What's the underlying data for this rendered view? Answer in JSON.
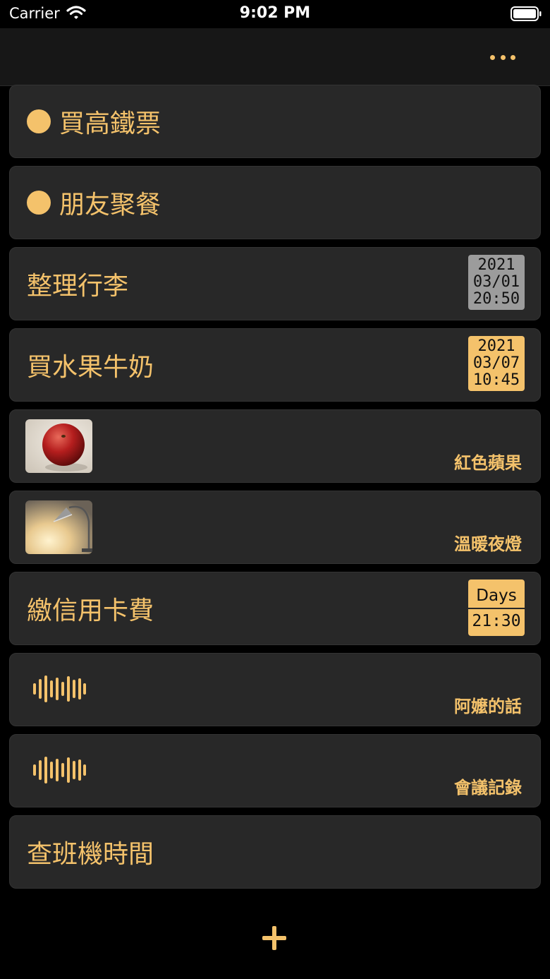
{
  "status_bar": {
    "carrier": "Carrier",
    "time": "9:02 PM"
  },
  "nav": {
    "more_icon": "ellipsis-icon"
  },
  "items": [
    {
      "kind": "dot",
      "title": "買高鐵票"
    },
    {
      "kind": "dot",
      "title": "朋友聚餐"
    },
    {
      "kind": "date",
      "title": "整理行李",
      "badge": {
        "year": "2021",
        "date": "03/01",
        "time": "20:50",
        "color": "#9c9c9c"
      }
    },
    {
      "kind": "date",
      "title": "買水果牛奶",
      "badge": {
        "year": "2021",
        "date": "03/07",
        "time": "10:45",
        "color": "#f4c26b"
      }
    },
    {
      "kind": "photo",
      "caption": "紅色蘋果",
      "photo": "red-apple-photo"
    },
    {
      "kind": "photo",
      "caption": "溫暖夜燈",
      "photo": "desk-lamp-photo"
    },
    {
      "kind": "days",
      "title": "繳信用卡費",
      "badge": {
        "label": "Days",
        "time": "21:30"
      }
    },
    {
      "kind": "audio",
      "caption": "阿嬤的話",
      "icon": "audio-waveform-icon"
    },
    {
      "kind": "audio",
      "caption": "會議記錄",
      "icon": "audio-waveform-icon"
    },
    {
      "kind": "text",
      "title": "查班機時間"
    }
  ],
  "accent_color": "#f4c26b",
  "add_icon": "plus-icon"
}
